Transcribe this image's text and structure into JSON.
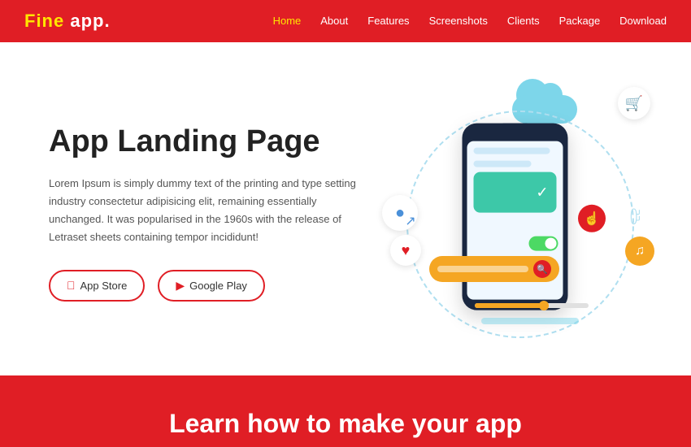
{
  "logo": {
    "fine": "Fine",
    "app": "app."
  },
  "nav": {
    "items": [
      {
        "label": "Home",
        "active": true
      },
      {
        "label": "About",
        "active": false
      },
      {
        "label": "Features",
        "active": false
      },
      {
        "label": "Screenshots",
        "active": false
      },
      {
        "label": "Clients",
        "active": false
      },
      {
        "label": "Package",
        "active": false
      },
      {
        "label": "Download",
        "active": false
      }
    ]
  },
  "hero": {
    "title": "App Landing Page",
    "description": "Lorem Ipsum is simply dummy text of the printing and type setting industry consectetur adipisicing elit, remaining essentially unchanged. It was popularised in the 1960s with the release of Letraset sheets containing tempor incididunt!",
    "btn_appstore": "App Store",
    "btn_googleplay": "Google Play"
  },
  "footer": {
    "tagline": "Learn how to make your app"
  }
}
